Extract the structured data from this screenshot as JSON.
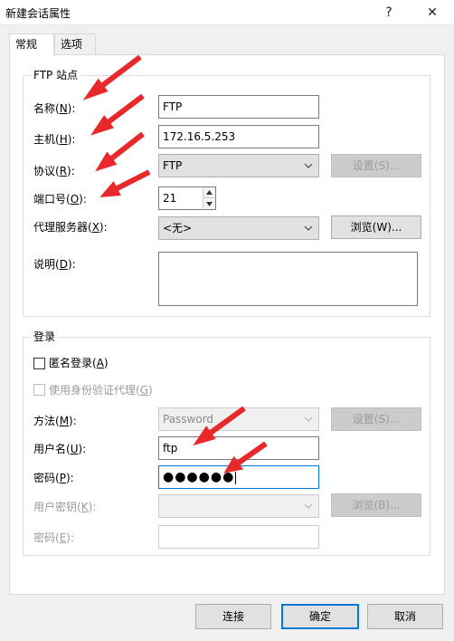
{
  "window": {
    "title": "新建会话属性",
    "help_label": "?",
    "close_label": "✕"
  },
  "tabs": [
    {
      "label": "常规",
      "active": true
    },
    {
      "label": "选项",
      "active": false
    }
  ],
  "ftp_site": {
    "legend": "FTP 站点",
    "name": {
      "label": "名称(",
      "key": "N",
      "suffix": "):",
      "value": "FTP"
    },
    "host": {
      "label": "主机(",
      "key": "H",
      "suffix": "):",
      "value": "172.16.5.253"
    },
    "protocol": {
      "label": "协议(",
      "key": "R",
      "suffix": "):",
      "value": "FTP",
      "settings_button": "设置(S)..."
    },
    "port": {
      "label": "端口号(",
      "key": "O",
      "suffix": "):",
      "value": "21"
    },
    "proxy": {
      "label": "代理服务器(",
      "key": "X",
      "suffix": "):",
      "value": "<无>",
      "browse_button": "浏览(W)..."
    },
    "description": {
      "label": "说明(",
      "key": "D",
      "suffix": "):",
      "value": ""
    }
  },
  "login": {
    "legend": "登录",
    "anonymous": {
      "label": "匿名登录(",
      "key": "A",
      "suffix": ")",
      "checked": false
    },
    "auth_proxy": {
      "label": "使用身份验证代理(",
      "key": "G",
      "suffix": ")",
      "checked": false
    },
    "method": {
      "label": "方法(",
      "key": "M",
      "suffix": "):",
      "value": "Password",
      "settings_button": "设置(S)..."
    },
    "username": {
      "label": "用户名(",
      "key": "U",
      "suffix": "):",
      "value": "ftp"
    },
    "password": {
      "label": "密码(",
      "key": "P",
      "suffix": "):",
      "value": "●●●●●●"
    },
    "user_key": {
      "label": "用户密钥(",
      "key": "K",
      "suffix": "):",
      "value": "",
      "browse_button": "浏览(B)..."
    },
    "passphrase": {
      "label": "密码(",
      "key": "E",
      "suffix": "):",
      "value": ""
    }
  },
  "footer": {
    "connect": "连接",
    "ok": "确定",
    "cancel": "取消"
  },
  "colors": {
    "accent": "#0078d7",
    "arrow": "#e8282a"
  }
}
